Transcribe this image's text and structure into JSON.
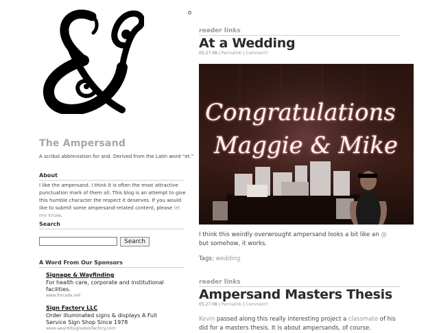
{
  "site": {
    "title": "The Ampersand",
    "tagline": "A scribal abbreviation for and. Derived from the Latin word “et.”"
  },
  "sidebar": {
    "about_heading": "About",
    "about_text": "I like the ampersand. I think it is often the most attractive punctuation mark of them all. This blog is an attempt to give this humble character the respect it deserves. If you would like to submit some ampersand-related content, please ",
    "about_link": "let me know",
    "about_end": ".",
    "search_heading": "Search",
    "search_value": "",
    "search_button": "Search",
    "sponsors_heading": "A Word From Our Sponsors",
    "ads": [
      {
        "title": "Signage & Wayfinding",
        "desc": "For health care, corporate and institutional facilities.",
        "url": "www.forcade.net"
      },
      {
        "title": "Sign Factory LLC",
        "desc": "Order illuminated signs & displays A Full Service Sign Shop Since 1978",
        "url": "www.awarditsignsdelsfactory.com"
      }
    ]
  },
  "posts": [
    {
      "category": "reader links",
      "title": "At a Wedding",
      "date": "05.27.08",
      "permalink": "Permalink",
      "comment": "Comment?",
      "photo_text_1": "Congratulations",
      "photo_text_2": "Maggie & Mike",
      "body_1": "I think this weirdly overwrought ampersand looks a bit like an ",
      "body_link": "@",
      "body_2": " but somehow, it works.",
      "tags_label": "Tags: ",
      "tag": "wedding"
    },
    {
      "category": "reader links",
      "title": "Ampersand Masters Thesis",
      "date": "05.27.08",
      "permalink": "Permalink",
      "comment": "Comment?",
      "body_link_1": "Kevin",
      "body_1": " passed along this really interesting project a ",
      "body_link_2": "classmate",
      "body_2": " of his did for a masters thesis. It is about ampersands, of course."
    }
  ],
  "colors": {
    "title_gray": "#a6a6a6",
    "link_gray": "#999999"
  }
}
